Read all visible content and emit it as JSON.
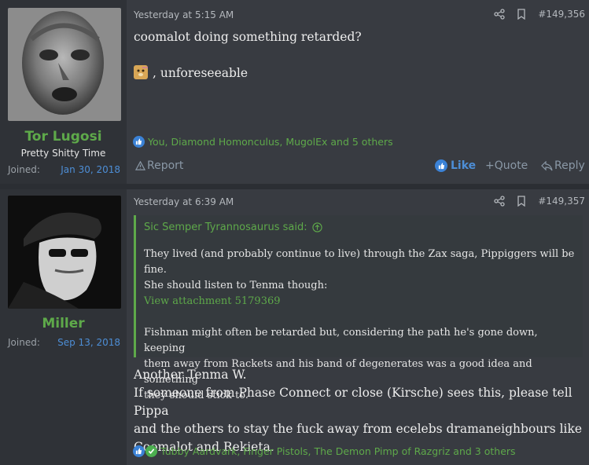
{
  "post1": {
    "username": "Tor Lugosi",
    "user_title": "Pretty Shitty Time",
    "joined_label": "Joined:",
    "joined_date": "Jan 30, 2018",
    "time": "Yesterday at 5:15 AM",
    "post_number": "#149,356",
    "body_line1": "coomalot doing something retarded?",
    "body_line2": ", unforeseeable",
    "reactions": "You, Diamond Homonculus, MugolEx and 5 others",
    "report_label": "Report",
    "like_label": "Like",
    "quote_label": "Quote",
    "reply_label": "Reply"
  },
  "post2": {
    "username": "Miller",
    "joined_label": "Joined:",
    "joined_date": "Sep 13, 2018",
    "time": "Yesterday at 6:39 AM",
    "post_number": "#149,357",
    "quote_author": "Sic Semper Tyrannosaurus said:",
    "quote_p1_l1": "They lived (and probably continue to live) through the Zax saga, Pippiggers will be fine.",
    "quote_p1_l2": "She should listen to Tenma though:",
    "quote_attachment": "View attachment 5179369",
    "quote_p2_l1": "Fishman might often be retarded but, considering the path he's gone down, keeping",
    "quote_p2_l2": "them away from Rackets and his band of degenerates was a good idea and something",
    "quote_p2_l3": "they should stick to.",
    "body_l1": "Another Tenma W.",
    "body_l2": "If someone from Phase Connect or close (Kirsche) sees this, please tell Pippa",
    "body_l3": "and the others to stay the fuck away from ecelebs dramaneighbours like",
    "body_l4": "Coomalot and Rekieta.",
    "reactions": "Tubby Aardvark, Finger Pistols, The Demon Pimp of Razgriz and 3 others"
  },
  "colors": {
    "accent_green": "#5ea94a",
    "link_blue": "#4d8ed6",
    "post_bg": "#383b41",
    "sidebar_bg": "#2f3237"
  }
}
